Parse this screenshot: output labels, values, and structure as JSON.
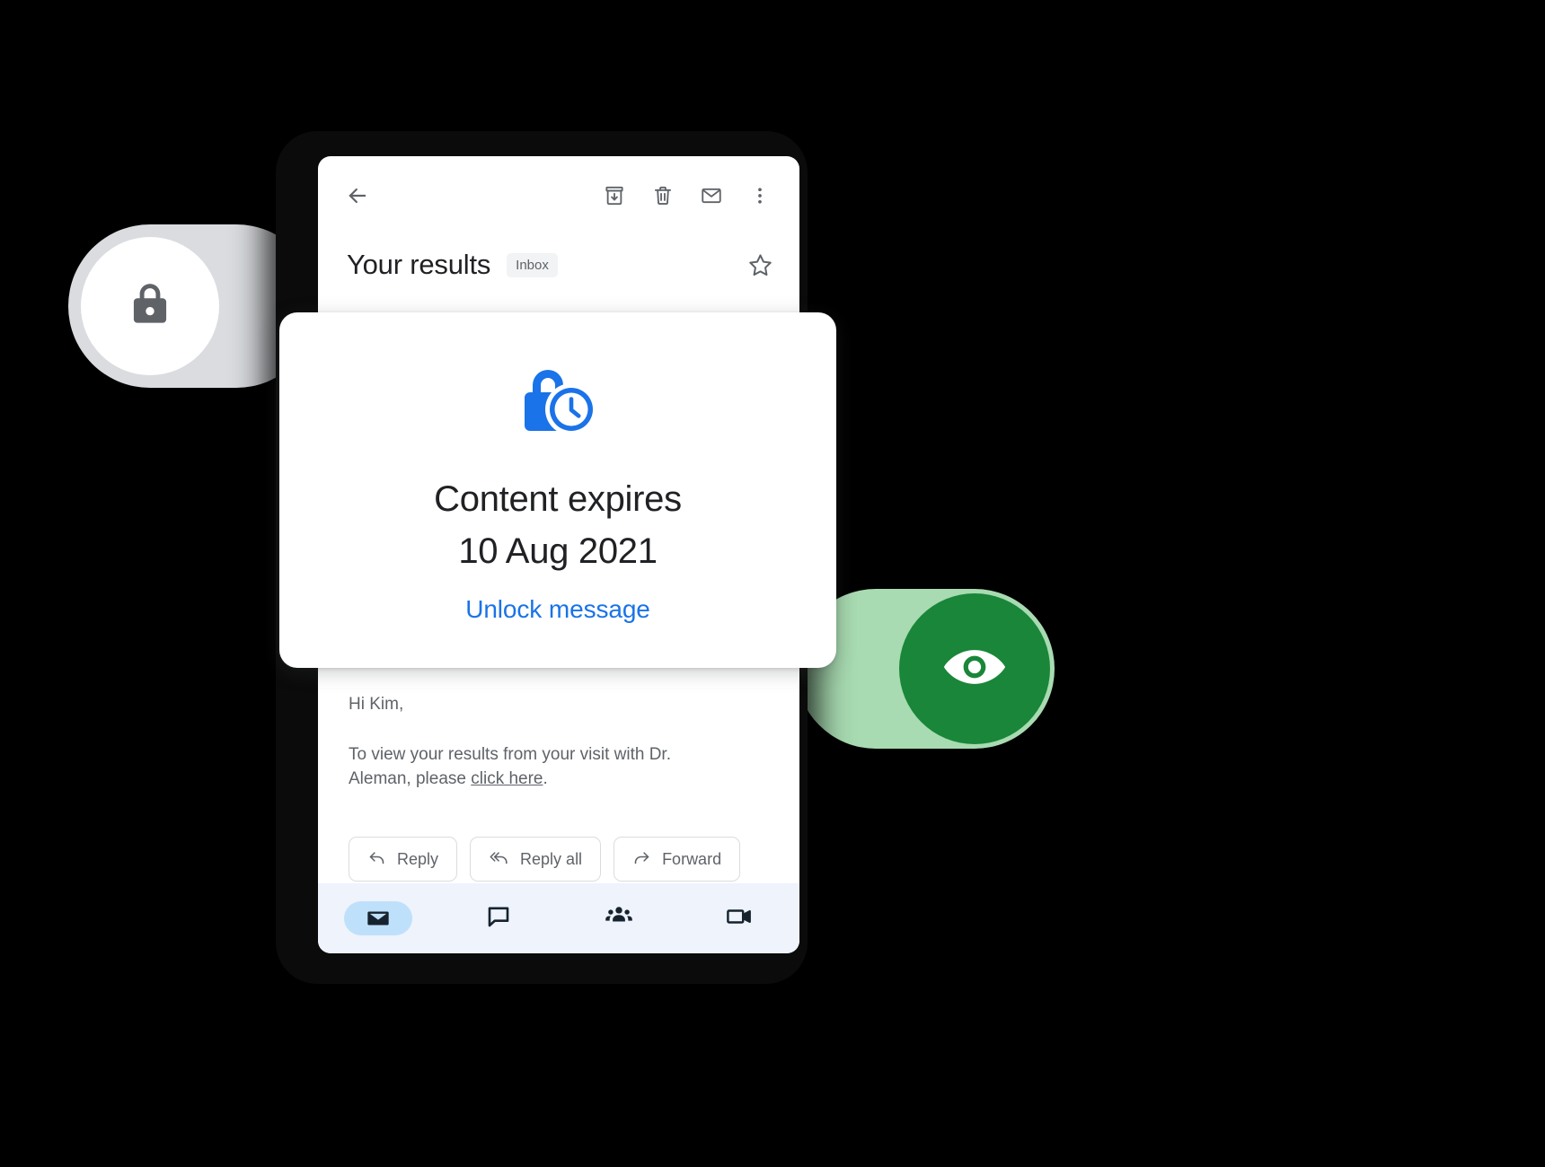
{
  "badges": {
    "lock": {
      "icon": "lock-icon",
      "pill_color": "#dadce0",
      "disc_color": "#ffffff",
      "glyph_color": "#5f6368"
    },
    "eye": {
      "icon": "eye-icon",
      "pill_color": "#a8dbb1",
      "disc_color": "#198639",
      "glyph_color": "#ffffff"
    }
  },
  "mail": {
    "toolbar": {
      "back_icon": "back-arrow-icon",
      "archive_icon": "archive-icon",
      "delete_icon": "trash-icon",
      "unread_icon": "mark-unread-icon",
      "overflow_icon": "more-vert-icon"
    },
    "subject": "Your results",
    "label_chip": "Inbox",
    "star_icon": "star-outline-icon",
    "body": {
      "greeting": "Hi Kim,",
      "paragraph_before": "To view your results from your visit with Dr. Aleman, please ",
      "link_text": "click here",
      "paragraph_after": "."
    },
    "actions": [
      {
        "label": "Reply",
        "icon": "reply-icon"
      },
      {
        "label": "Reply all",
        "icon": "reply-all-icon"
      },
      {
        "label": "Forward",
        "icon": "forward-icon"
      }
    ],
    "bottom_nav": [
      {
        "name": "mail",
        "icon": "mail-icon",
        "active": true
      },
      {
        "name": "chat",
        "icon": "chat-bubble-icon",
        "active": false
      },
      {
        "name": "rooms",
        "icon": "people-group-icon",
        "active": false
      },
      {
        "name": "meet",
        "icon": "video-camera-icon",
        "active": false
      }
    ]
  },
  "expiry_card": {
    "icon": "lock-clock-icon",
    "icon_color": "#1a73e8",
    "line1": "Content expires",
    "line2": "10 Aug 2021",
    "action_label": "Unlock message",
    "action_color": "#1a73e8"
  }
}
